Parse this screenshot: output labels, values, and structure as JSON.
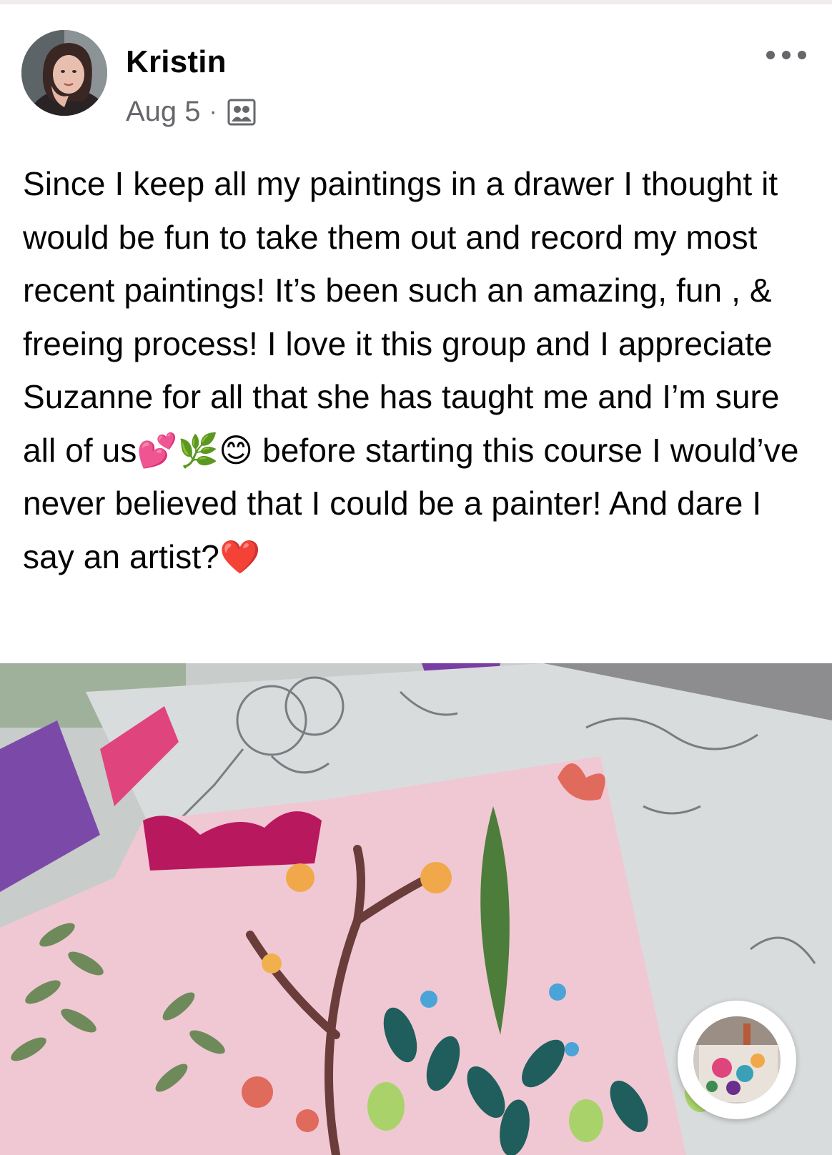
{
  "post": {
    "author": "Kristin",
    "date": "Aug 5",
    "separator": "·",
    "privacy_icon": "group-members-icon",
    "more_icon": "more-options-icon",
    "text": "Since I keep all my paintings in a drawer I thought it would be fun to take them out and record my most recent paintings! It’s been such an amazing, fun , & freeing process! I love it this group and I appreciate Suzanne for all that she has taught me and I’m sure all of us💕🌿😊 before starting this course I would’ve never believed that I could be a painter! And dare I say an artist?❤️"
  },
  "media": {
    "type": "video-thumbnail",
    "subject": "paintings of flowers and leaves spread on a table",
    "mini_player_icon": "mini-video-thumbnail"
  },
  "colors": {
    "secondary_text": "#65676b",
    "primary_text": "#050505",
    "background": "#ffffff"
  }
}
